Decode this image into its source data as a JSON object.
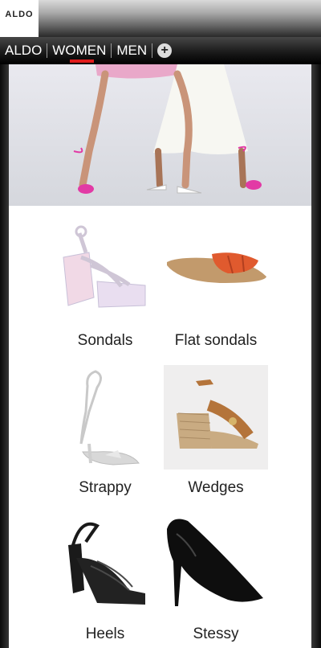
{
  "brand": {
    "logo_text": "ALDO"
  },
  "tabs": [
    {
      "label": "ALDO"
    },
    {
      "label": "WOMEN",
      "active": true
    },
    {
      "label": "MEN"
    }
  ],
  "add_tab_icon": "plus-circle-icon",
  "categories": [
    {
      "label": "Sondals",
      "icon": "platform-sandal"
    },
    {
      "label": "Flat sondals",
      "icon": "slide-sandal"
    },
    {
      "label": "Strappy",
      "icon": "strappy-heel"
    },
    {
      "label": "Wedges",
      "icon": "wedge-sandal"
    },
    {
      "label": "Heels",
      "icon": "platform-heel"
    },
    {
      "label": "Stessy",
      "icon": "pump"
    }
  ],
  "colors": {
    "accent": "#e01b1b"
  }
}
